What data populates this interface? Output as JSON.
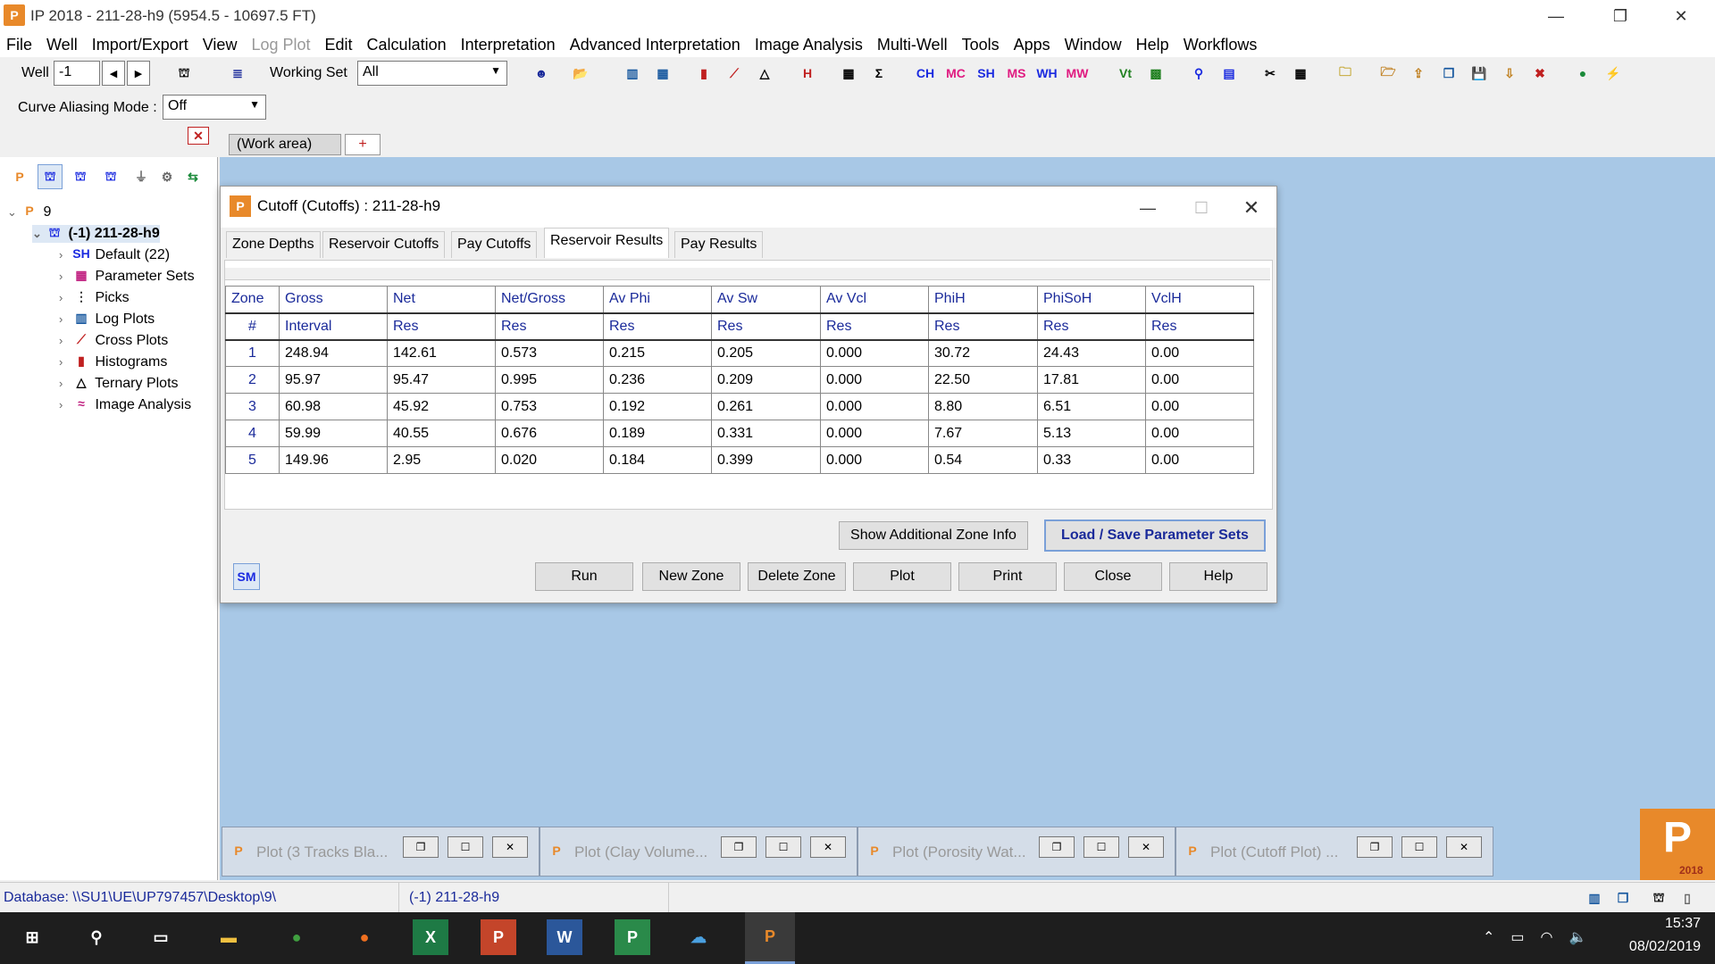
{
  "window": {
    "title": "IP 2018 - 211-28-h9 (5954.5 - 10697.5 FT)"
  },
  "menu": [
    "File",
    "Well",
    "Import/Export",
    "View",
    "Log Plot",
    "Edit",
    "Calculation",
    "Interpretation",
    "Advanced Interpretation",
    "Image Analysis",
    "Multi-Well",
    "Tools",
    "Apps",
    "Window",
    "Help",
    "Workflows"
  ],
  "toolbar": {
    "well_label": "Well",
    "well_value": "-1",
    "working_set_label": "Working Set",
    "working_set_value": "All",
    "curve_aliasing_label": "Curve Aliasing Mode :",
    "curve_aliasing_value": "Off",
    "zone_buttons": [
      "CH",
      "MC",
      "SH",
      "MS",
      "WH",
      "MW"
    ]
  },
  "tabs": {
    "work_area": "(Work area)",
    "add": "+"
  },
  "tree": {
    "root": "9",
    "well": "(-1) 211-28-h9",
    "items": [
      "Default (22)",
      "Parameter Sets",
      "Picks",
      "Log Plots",
      "Cross Plots",
      "Histograms",
      "Ternary Plots",
      "Image Analysis"
    ]
  },
  "dialog": {
    "title": "Cutoff (Cutoffs) : 211-28-h9",
    "tabs": [
      "Zone Depths",
      "Reservoir Cutoffs",
      "Pay Cutoffs",
      "Reservoir Results",
      "Pay Results"
    ],
    "active_tab": "Reservoir Results",
    "header1": [
      "Zone",
      "Gross",
      "Net",
      "Net/Gross",
      "Av Phi",
      "Av Sw",
      "Av Vcl",
      "PhiH",
      "PhiSoH",
      "VclH"
    ],
    "header2": [
      "#",
      "Interval",
      "Res",
      "Res",
      "Res",
      "Res",
      "Res",
      "Res",
      "Res",
      "Res"
    ],
    "rows": [
      [
        "1",
        "248.94",
        "142.61",
        "0.573",
        "0.215",
        "0.205",
        "0.000",
        "30.72",
        "24.43",
        "0.00"
      ],
      [
        "2",
        "95.97",
        "95.47",
        "0.995",
        "0.236",
        "0.209",
        "0.000",
        "22.50",
        "17.81",
        "0.00"
      ],
      [
        "3",
        "60.98",
        "45.92",
        "0.753",
        "0.192",
        "0.261",
        "0.000",
        "8.80",
        "6.51",
        "0.00"
      ],
      [
        "4",
        "59.99",
        "40.55",
        "0.676",
        "0.189",
        "0.331",
        "0.000",
        "7.67",
        "5.13",
        "0.00"
      ],
      [
        "5",
        "149.96",
        "2.95",
        "0.020",
        "0.184",
        "0.399",
        "0.000",
        "0.54",
        "0.33",
        "0.00"
      ]
    ],
    "show_zone_info": "Show Additional Zone Info",
    "load_save": "Load / Save Parameter Sets",
    "sm_icon": "SM",
    "buttons": [
      "Run",
      "New Zone",
      "Delete Zone",
      "Plot",
      "Print",
      "Close",
      "Help"
    ]
  },
  "minimized": [
    "Plot (3 Tracks Bla...",
    "Plot (Clay Volume...",
    "Plot (Porosity Wat...",
    "Plot (Cutoff Plot) ..."
  ],
  "status": {
    "database": "Database: \\\\SU1\\UE\\UP797457\\Desktop\\9\\",
    "well": "(-1) 211-28-h9"
  },
  "taskbar": {
    "time": "15:37",
    "date": "08/02/2019"
  },
  "logo_text": "2018"
}
